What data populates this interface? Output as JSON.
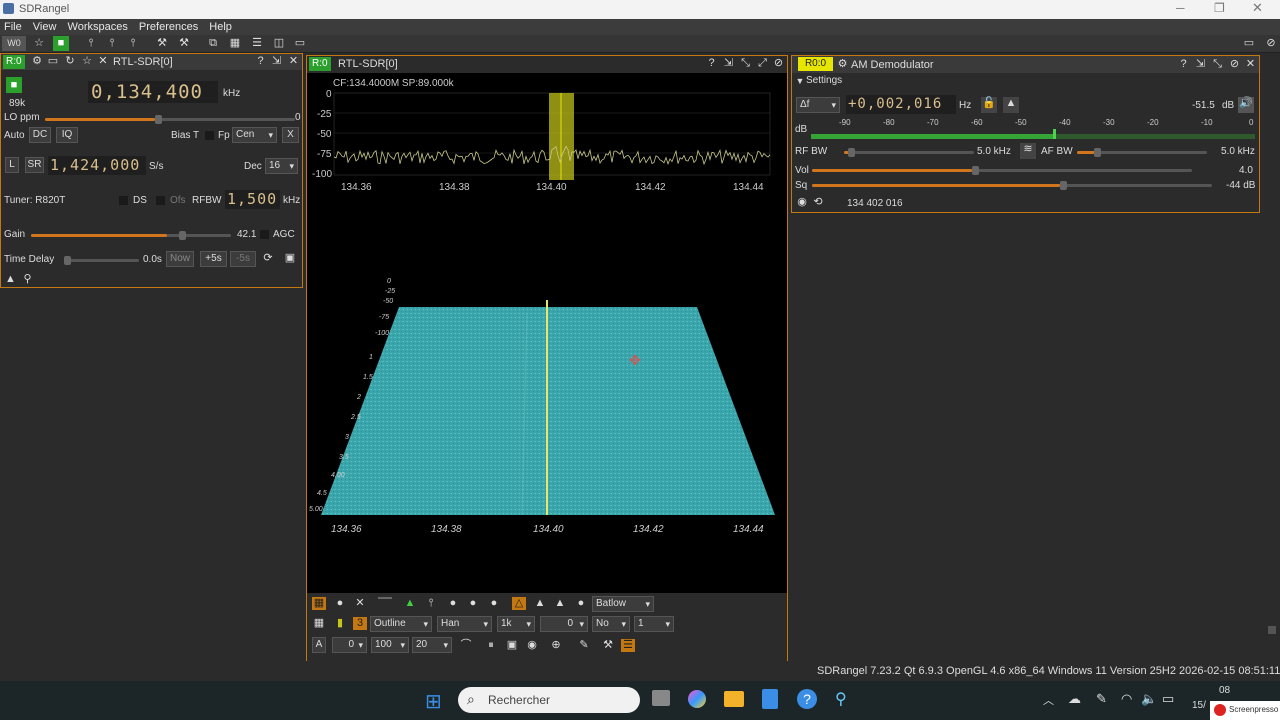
{
  "app": {
    "title": "SDRangel",
    "status": "SDRangel 7.23.2 Qt 6.9.3 OpenGL 4.6 x86_64 Windows 11 Version 25H2  2026-02-15 08:51:11 GMT+1"
  },
  "menu": [
    "File",
    "View",
    "Workspaces",
    "Preferences",
    "Help"
  ],
  "workspace": "W0",
  "device": {
    "tag": "R:0",
    "name": "RTL-SDR[0]",
    "freq": "0,134,400",
    "freq_unit": "kHz",
    "sr_label": "89k",
    "lo_ppm_label": "LO ppm",
    "lo_ppm_value": "0",
    "auto": "Auto",
    "dc": "DC",
    "iq": "IQ",
    "bias_t": "Bias T",
    "fp": "Fp",
    "fp_value": "Cen",
    "x": "X",
    "l": "L",
    "sr": "SR",
    "sample_rate": "1,424,000",
    "sr_unit": "S/s",
    "dec": "Dec",
    "dec_value": "16",
    "tuner": "Tuner: R820T",
    "ds": "DS",
    "ofs": "Ofs",
    "rfbw": "RFBW",
    "rfbw_value": "1,500",
    "rfbw_unit": "kHz",
    "gain": "Gain",
    "gain_value": "42.1",
    "agc": "AGC",
    "gain_level": 0.68,
    "time_delay": "Time Delay",
    "td_value": "0.0s",
    "now": "Now",
    "plus5": "+5s",
    "minus5": "-5s"
  },
  "spectrum": {
    "tag": "R:0",
    "name": "RTL-SDR[0]",
    "cf": "CF:134.4000M SP:89.000k",
    "yticks": [
      "0",
      "-25",
      "-50",
      "-75",
      "-100"
    ],
    "xticks": [
      "134.36",
      "134.38",
      "134.40",
      "134.42",
      "134.44"
    ],
    "wf_xticks": [
      "134.36",
      "134.38",
      "134.40",
      "134.42",
      "134.44"
    ],
    "wf_ticks": [
      "0",
      "-25",
      "-50",
      "-75",
      "-100",
      "1",
      "1.5",
      "2",
      "2.5",
      "3",
      "3.5",
      "4.00",
      "4.5",
      "5.00"
    ],
    "window": "Batlow",
    "style": "Outline",
    "fft_window": "Han",
    "fft_size": "1k",
    "ref": "0",
    "avg": "No",
    "avg_n": "1",
    "a": "A",
    "v1": "0",
    "v2": "100",
    "v3": "20"
  },
  "demod": {
    "tag": "R0:0",
    "name": "AM Demodulator",
    "settings": "Settings",
    "df": "Δf",
    "offset": "+0,002,016",
    "offset_unit": "Hz",
    "level": "-51.5",
    "level_unit": "dB",
    "db": "dB",
    "scale": [
      "-90",
      "-80",
      "-70",
      "-60",
      "-50",
      "-40",
      "-30",
      "-20",
      "-10",
      "0"
    ],
    "rfbw": "RF BW",
    "rfbw_value": "5.0 kHz",
    "afbw": "AF BW",
    "afbw_value": "5.0 kHz",
    "vol": "Vol",
    "vol_value": "4.0",
    "sq": "Sq",
    "sq_value": "-44 dB",
    "freq": "134 402 016"
  },
  "taskbar": {
    "search": "Rechercher",
    "time": "08",
    "date": "15/",
    "watermark": "Screenpresso"
  }
}
